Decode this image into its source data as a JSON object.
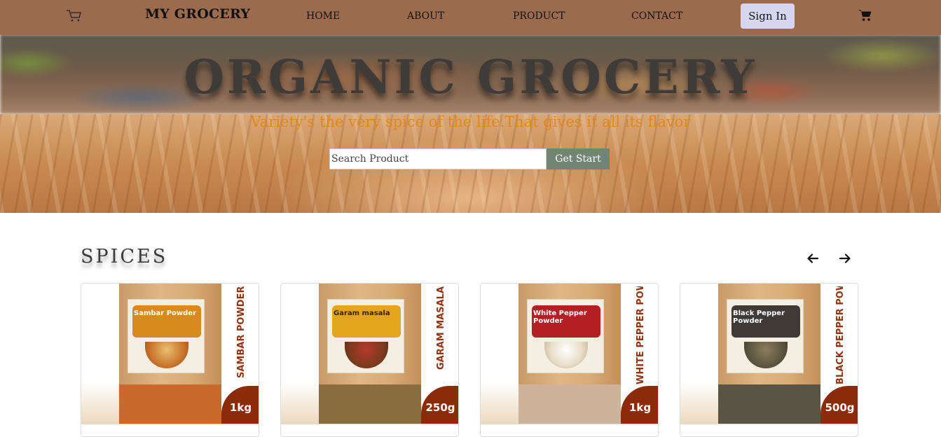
{
  "nav": {
    "brand": "MY GROCERY",
    "links": [
      "HOME",
      "ABOUT",
      "PRODUCT",
      "CONTACT"
    ],
    "signin_label": "Sign In",
    "logo_icon": "cart-icon",
    "cart_icon": "cart-icon"
  },
  "hero": {
    "title": "ORGANIC GROCERY",
    "tagline": "Variety's the very spice of the life.That gives it all its flavor",
    "search_placeholder": "Search Product",
    "cta_label": "Get Start"
  },
  "spices": {
    "title": "SPICES",
    "prev_icon": "arrow-left-icon",
    "next_icon": "arrow-right-icon",
    "products": [
      {
        "label_name": "Sambar Powder",
        "band_text": "SAMBAR POWDER",
        "weight": "1kg",
        "splash_color": "#d88a1d",
        "bottom_color": "#c76a2a"
      },
      {
        "label_name": "Garam masala",
        "band_text": "GARAM MASALA",
        "weight": "250g",
        "splash_color": "#e3a51e",
        "bottom_color": "#8a6d3e"
      },
      {
        "label_name": "White Pepper Powder",
        "band_text": "WHITE PEPPER POWDER",
        "weight": "1kg",
        "splash_color": "#b21f24",
        "bottom_color": "#cdb39a"
      },
      {
        "label_name": "Black Pepper Powder",
        "band_text": "BLACK PEPPER POWD",
        "weight": "500g",
        "splash_color": "#3f3a36",
        "bottom_color": "#5a5445"
      }
    ]
  },
  "colors": {
    "navbar": "#9c6a4c",
    "signin_bg": "#d8d5f0",
    "cta_bg": "#728472",
    "tagline": "#e3861b",
    "band_accent": "#8c2b08"
  }
}
